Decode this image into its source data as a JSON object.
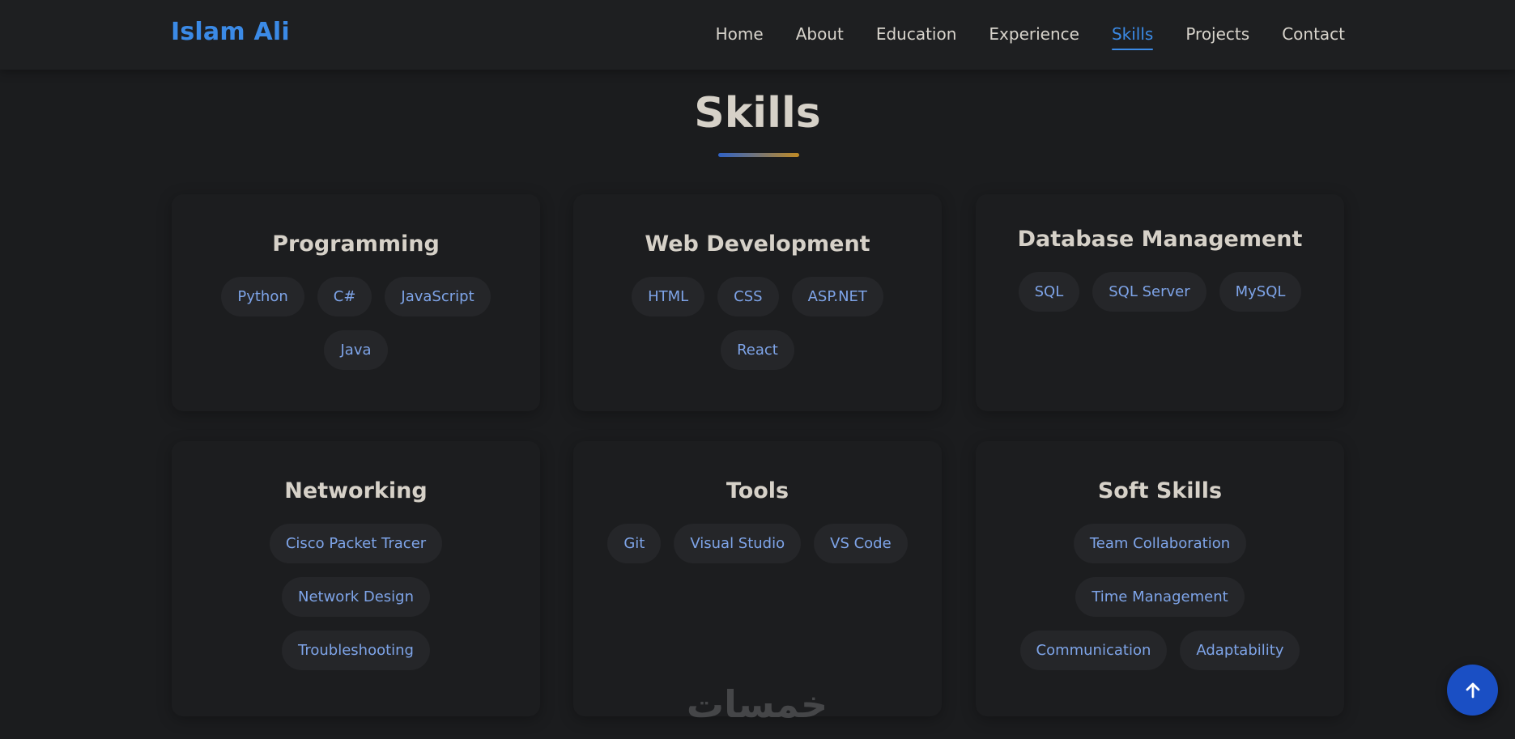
{
  "header": {
    "brand": "Islam Ali",
    "nav": [
      "Home",
      "About",
      "Education",
      "Experience",
      "Skills",
      "Projects",
      "Contact"
    ],
    "active": "Skills"
  },
  "section": {
    "title": "Skills"
  },
  "categories": [
    {
      "title": "Programming",
      "skills": [
        "Python",
        "C#",
        "JavaScript",
        "Java"
      ]
    },
    {
      "title": "Web Development",
      "skills": [
        "HTML",
        "CSS",
        "ASP.NET",
        "React"
      ]
    },
    {
      "title": "Database Management",
      "skills": [
        "SQL",
        "SQL Server",
        "MySQL"
      ]
    },
    {
      "title": "Networking",
      "skills": [
        "Cisco Packet Tracer",
        "Network Design",
        "Troubleshooting"
      ]
    },
    {
      "title": "Tools",
      "skills": [
        "Git",
        "Visual Studio",
        "VS Code"
      ]
    },
    {
      "title": "Soft Skills",
      "skills": [
        "Team Collaboration",
        "Time Management",
        "Communication",
        "Adaptability"
      ]
    }
  ],
  "colors": {
    "accent": "#3b8ae6",
    "tag_text": "#7ea4e8",
    "button": "#1a4fc4"
  },
  "icons": {
    "back_to_top": "arrow-up-icon"
  },
  "watermark": {
    "text": "خمسات"
  }
}
